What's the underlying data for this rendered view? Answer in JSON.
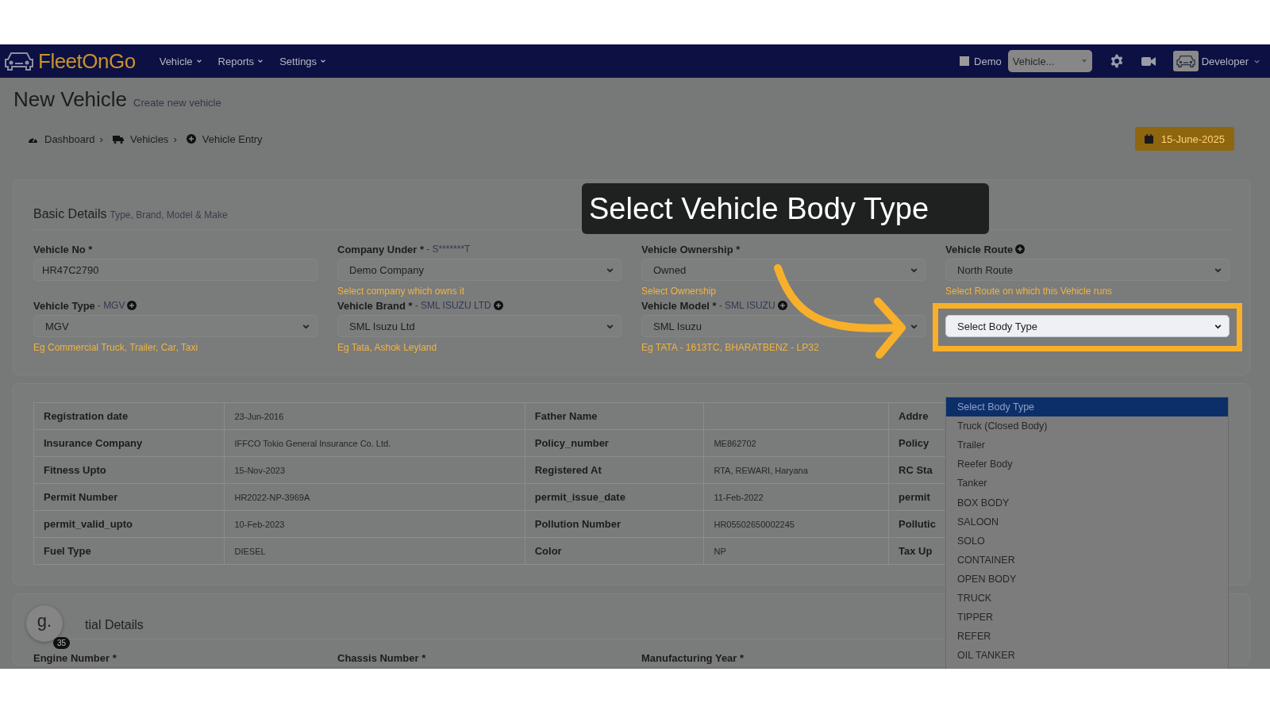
{
  "navbar": {
    "logo": "FleetOnGo",
    "menu": [
      {
        "label": "Vehicle"
      },
      {
        "label": "Reports"
      },
      {
        "label": "Settings"
      }
    ],
    "demo": {
      "label": "Demo",
      "checked": false
    },
    "vehicle_select": {
      "value": "Vehicle..."
    },
    "user": "Developer"
  },
  "page_header": {
    "title": "New Vehicle",
    "subtitle": "Create new vehicle"
  },
  "breadcrumb": [
    {
      "label": "Dashboard",
      "separator": "›"
    },
    {
      "label": "Vehicles",
      "separator": "›"
    },
    {
      "label": "Vehicle Entry"
    }
  ],
  "date_button": "15-June-2025",
  "basic_details": {
    "title": "Basic Details",
    "subtitle": "Type, Brand, Model & Make",
    "fields": [
      {
        "kind": "input",
        "label": "Vehicle No *",
        "value": "HR47C2790"
      },
      {
        "kind": "select",
        "label": "Company Under *",
        "note": " - S*******T",
        "value": "Demo Company",
        "hint": "Select company which owns it"
      },
      {
        "kind": "select",
        "label": "Vehicle Ownership *",
        "value": "Owned",
        "hint": "Select Ownership"
      },
      {
        "kind": "select",
        "label": "Vehicle Route",
        "add": true,
        "value": "North Route",
        "hint": "Select Route on which this Vehicle runs"
      },
      {
        "kind": "select",
        "label": "Vehicle Type",
        "note": " - MGV",
        "add": true,
        "value": "MGV",
        "hint": "Eg Commercial Truck, Trailer, Car, Taxi"
      },
      {
        "kind": "select",
        "label": "Vehicle Brand *",
        "note": " - SML ISUZU LTD",
        "add": true,
        "value": "SML Isuzu Ltd",
        "hint": "Eg Tata, Ashok Leyland"
      },
      {
        "kind": "select",
        "label": "Vehicle Model *",
        "note": " - SML ISUZU",
        "add": true,
        "value": "SML Isuzu",
        "hint": "Eg TATA - 1613TC, BHARATBENZ - LP32"
      },
      {
        "kind": "select",
        "value": "Select Body Type",
        "highlighted": true
      }
    ]
  },
  "details_table": {
    "rows": [
      [
        "Registration date",
        "23-Jun-2016",
        "Father Name",
        "",
        "Addre"
      ],
      [
        "Insurance Company",
        "IFFCO Tokio General Insurance Co. Ltd.",
        "Policy_number",
        "ME862702",
        "Policy"
      ],
      [
        "Fitness Upto",
        "15-Nov-2023",
        "Registered At",
        "RTA, REWARI, Haryana",
        "RC Sta"
      ],
      [
        "Permit Number",
        "HR2022-NP-3969A",
        "permit_issue_date",
        "11-Feb-2022",
        "permit"
      ],
      [
        "permit_valid_upto",
        "10-Feb-2023",
        "Pollution Number",
        "HR05502650002245",
        "Pollutic"
      ],
      [
        "Fuel Type",
        "DIESEL",
        "Color",
        "NP",
        "Tax Up"
      ]
    ]
  },
  "additional_details": {
    "title": "tial Details",
    "fields": [
      "Engine Number *",
      "Chassis Number *",
      "Manufacturing Year *"
    ]
  },
  "chat_bubble": {
    "letter": "g.",
    "count": "35"
  },
  "tour": {
    "caption": "Select Vehicle Body Type"
  },
  "body_type_dropdown": {
    "options": [
      {
        "label": "Select Body Type",
        "selected": true
      },
      {
        "label": "Truck (Closed Body)",
        "selected": false
      },
      {
        "label": "Trailer",
        "selected": false
      },
      {
        "label": "Reefer Body",
        "selected": false
      },
      {
        "label": "Tanker",
        "selected": false
      },
      {
        "label": "BOX BODY",
        "selected": false
      },
      {
        "label": "SALOON",
        "selected": false
      },
      {
        "label": "SOLO",
        "selected": false
      },
      {
        "label": "CONTAINER",
        "selected": false
      },
      {
        "label": "OPEN BODY",
        "selected": false
      },
      {
        "label": "TRUCK",
        "selected": false
      },
      {
        "label": "TIPPER",
        "selected": false
      },
      {
        "label": "REFER",
        "selected": false
      },
      {
        "label": "OIL TANKER",
        "selected": false
      }
    ]
  }
}
